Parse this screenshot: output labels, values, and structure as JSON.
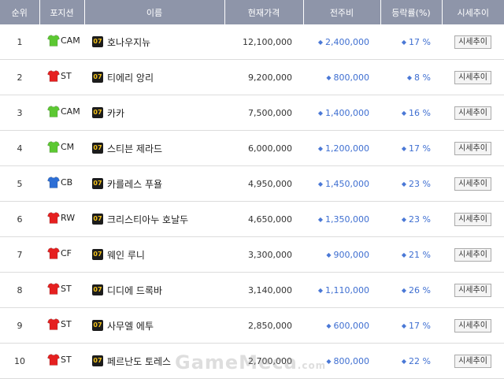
{
  "header": {
    "rank": "순위",
    "position": "포지션",
    "name": "이름",
    "current_price": "현재가격",
    "change": "전주비",
    "rate": "등락률(%)",
    "trend": "시세추이"
  },
  "colors": {
    "shirt_green": "#5cc832",
    "shirt_red": "#e52020",
    "shirt_blue": "#2d6fd6",
    "header_bg": "#8e95a9",
    "up_arrow": "#4a78d6"
  },
  "rows": [
    {
      "rank": "1",
      "shirt": "green",
      "position": "CAM",
      "season": "07",
      "name": "호나우지뉴",
      "price": "12,100,000",
      "arrow": "◆",
      "change": "2,400,000",
      "rate_arrow": "◆",
      "rate": "17 %",
      "button": "시세추이"
    },
    {
      "rank": "2",
      "shirt": "red",
      "position": "ST",
      "season": "07",
      "name": "티에리 앙리",
      "price": "9,200,000",
      "arrow": "◆",
      "change": "800,000",
      "rate_arrow": "◆",
      "rate": "8 %",
      "button": "시세추이"
    },
    {
      "rank": "3",
      "shirt": "green",
      "position": "CAM",
      "season": "07",
      "name": "카카",
      "price": "7,500,000",
      "arrow": "◆",
      "change": "1,400,000",
      "rate_arrow": "◆",
      "rate": "16 %",
      "button": "시세추이"
    },
    {
      "rank": "4",
      "shirt": "green",
      "position": "CM",
      "season": "07",
      "name": "스티븐 제라드",
      "price": "6,000,000",
      "arrow": "◆",
      "change": "1,200,000",
      "rate_arrow": "◆",
      "rate": "17 %",
      "button": "시세추이"
    },
    {
      "rank": "5",
      "shirt": "blue",
      "position": "CB",
      "season": "07",
      "name": "카를레스 푸욜",
      "price": "4,950,000",
      "arrow": "◆",
      "change": "1,450,000",
      "rate_arrow": "◆",
      "rate": "23 %",
      "button": "시세추이"
    },
    {
      "rank": "6",
      "shirt": "red",
      "position": "RW",
      "season": "07",
      "name": "크리스티아누 호날두",
      "price": "4,650,000",
      "arrow": "◆",
      "change": "1,350,000",
      "rate_arrow": "◆",
      "rate": "23 %",
      "button": "시세추이"
    },
    {
      "rank": "7",
      "shirt": "red",
      "position": "CF",
      "season": "07",
      "name": "웨인 루니",
      "price": "3,300,000",
      "arrow": "◆",
      "change": "900,000",
      "rate_arrow": "◆",
      "rate": "21 %",
      "button": "시세추이"
    },
    {
      "rank": "8",
      "shirt": "red",
      "position": "ST",
      "season": "07",
      "name": "디디에 드록바",
      "price": "3,140,000",
      "arrow": "◆",
      "change": "1,110,000",
      "rate_arrow": "◆",
      "rate": "26 %",
      "button": "시세추이"
    },
    {
      "rank": "9",
      "shirt": "red",
      "position": "ST",
      "season": "07",
      "name": "사무엘 에투",
      "price": "2,850,000",
      "arrow": "◆",
      "change": "600,000",
      "rate_arrow": "◆",
      "rate": "17 %",
      "button": "시세추이"
    },
    {
      "rank": "10",
      "shirt": "red",
      "position": "ST",
      "season": "07",
      "name": "페르난도 토레스",
      "price": "2,700,000",
      "arrow": "◆",
      "change": "800,000",
      "rate_arrow": "◆",
      "rate": "22 %",
      "button": "시세추이"
    }
  ],
  "watermark": {
    "text": "GameMeca",
    "suffix": ".com"
  }
}
